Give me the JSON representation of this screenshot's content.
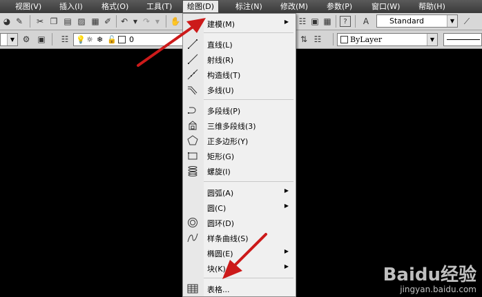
{
  "menubar": {
    "items": [
      {
        "label": "视图(V)"
      },
      {
        "label": "插入(I)"
      },
      {
        "label": "格式(O)"
      },
      {
        "label": "工具(T)"
      },
      {
        "label": "绘图(D)",
        "active": true
      },
      {
        "label": "标注(N)"
      },
      {
        "label": "修改(M)"
      },
      {
        "label": "参数(P)"
      },
      {
        "label": "窗口(W)"
      },
      {
        "label": "帮助(H)"
      }
    ]
  },
  "toolbar": {
    "style_combo": "Standard",
    "layer_value": "0",
    "linetype_combo": "ByLayer"
  },
  "draw_menu": {
    "items": [
      {
        "label": "建模(M)",
        "submenu": true,
        "icon": "none"
      },
      {
        "label": "直线(L)",
        "icon": "line-icon"
      },
      {
        "label": "射线(R)",
        "icon": "ray-icon"
      },
      {
        "label": "构造线(T)",
        "icon": "construction-line-icon"
      },
      {
        "label": "多线(U)",
        "icon": "multiline-icon"
      },
      {
        "label": "多段线(P)",
        "icon": "polyline-icon"
      },
      {
        "label": "三维多段线(3)",
        "icon": "3d-polyline-icon"
      },
      {
        "label": "正多边形(Y)",
        "icon": "polygon-icon"
      },
      {
        "label": "矩形(G)",
        "icon": "rectangle-icon"
      },
      {
        "label": "螺旋(I)",
        "icon": "helix-icon"
      },
      {
        "label": "圆弧(A)",
        "submenu": true,
        "icon": "none"
      },
      {
        "label": "圆(C)",
        "submenu": true,
        "icon": "none"
      },
      {
        "label": "圆环(D)",
        "icon": "donut-icon"
      },
      {
        "label": "样条曲线(S)",
        "icon": "spline-icon"
      },
      {
        "label": "椭圆(E)",
        "submenu": true,
        "icon": "none"
      },
      {
        "label": "块(K)",
        "submenu": true,
        "icon": "none"
      },
      {
        "label": "表格...",
        "icon": "table-icon"
      }
    ]
  },
  "annotation": {
    "color": "#cc1a1a"
  },
  "watermark": {
    "logo_text": "Baidu经验",
    "url_text": "jingyan.baidu.com"
  }
}
